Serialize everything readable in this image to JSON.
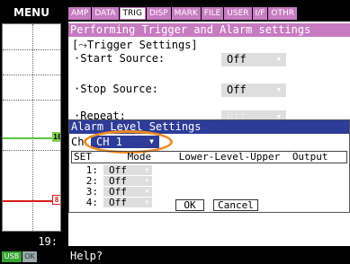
{
  "menu_label": "MENU",
  "time_label": "19:",
  "usb_label": "USB",
  "ok_label": "OK",
  "graph_markers": {
    "green": "10",
    "red": "8"
  },
  "tabs": [
    "AMP",
    "DATA",
    "TRIG",
    "DISP",
    "MARK",
    "FILE",
    "USER",
    "I/F",
    "OTHR"
  ],
  "active_tab": "TRIG",
  "panel": {
    "title": "Performing Trigger and Alarm settings",
    "section": "[⤳Trigger Settings]",
    "start_label": "·Start Source:",
    "start_value": "Off",
    "stop_label": "·Stop Source:",
    "stop_value": "Off",
    "repeat_label": "·Repeat:",
    "repeat_value": "Off",
    "bracket": "[",
    "partial_c": "C"
  },
  "dialog": {
    "title": "Alarm Level Settings",
    "ch_label": "Ch",
    "ch_value": "CH 1",
    "headers": {
      "set": "SET",
      "mode": "Mode",
      "range": "Lower-Level-Upper",
      "output": "Output"
    },
    "rows": [
      {
        "num": "1:",
        "mode": "Off"
      },
      {
        "num": "2:",
        "mode": "Off"
      },
      {
        "num": "3:",
        "mode": "Off"
      },
      {
        "num": "4:",
        "mode": "Off"
      }
    ],
    "ok_label": "OK",
    "cancel_label": "Cancel"
  },
  "help_text": "Help?",
  "colors": {
    "accent": "#c77bc1",
    "dialog": "#2d3c98",
    "highlight": "#ef8a22",
    "trace_green": "#59c542",
    "trace_red": "#d81b1b"
  }
}
